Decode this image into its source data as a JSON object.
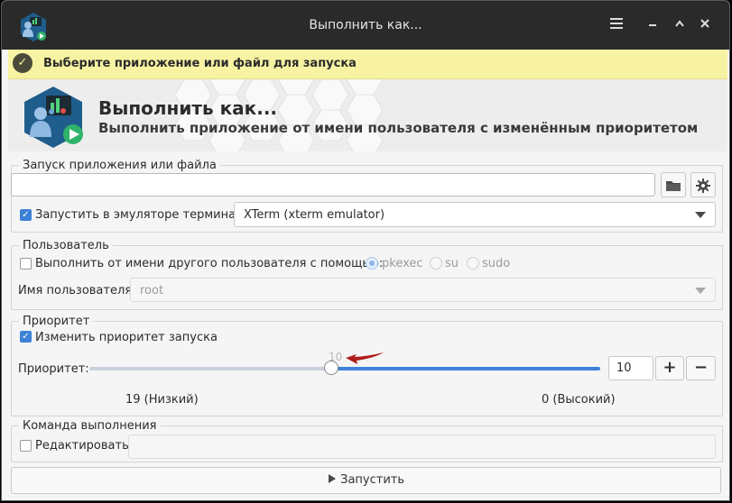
{
  "window": {
    "title": "Выполнить как..."
  },
  "infobar": {
    "message": "Выберите приложение или файл для запуска"
  },
  "banner": {
    "title": "Выполнить как...",
    "subtitle": "Выполнить приложение от имени пользователя с изменённым приоритетом"
  },
  "launch": {
    "legend": "Запуск приложения или файла",
    "command_value": "",
    "terminal_label": "Запустить в эмуляторе терминала",
    "terminal_checked": true,
    "terminal_selected": "XTerm (xterm emulator)"
  },
  "user": {
    "legend": "Пользователь",
    "other_user_label": "Выполнить от имени другого пользователя с помощью:",
    "other_user_checked": false,
    "methods": [
      "pkexec",
      "su",
      "sudo"
    ],
    "selected_method": "pkexec",
    "username_label": "Имя пользователя:",
    "username_value": "root"
  },
  "priority": {
    "legend": "Приоритет",
    "change_label": "Изменить приоритет запуска",
    "change_checked": true,
    "label": "Приоритет:",
    "value": 10,
    "value_text": "10",
    "slider_marker": "10",
    "min": 0,
    "max": 19,
    "low_label": "19 (Низкий)",
    "high_label": "0 (Высокий)",
    "plus_label": "+",
    "minus_label": "−"
  },
  "command": {
    "legend": "Команда выполнения",
    "edit_label": "Редактировать",
    "edit_checked": false,
    "value": ""
  },
  "run_button": {
    "label": "Запустить"
  },
  "icons": [
    "app-icon",
    "menu-icon",
    "minimize-icon",
    "maximize-icon",
    "close-icon",
    "check-icon",
    "folder-icon",
    "gear-icon",
    "chevron-down-icon",
    "play-icon"
  ],
  "colors": {
    "accent": "#3d82d8",
    "infobar": "#f7f3a3",
    "titlebar": "#2a2a2a",
    "annotation": "#b11c1c"
  }
}
